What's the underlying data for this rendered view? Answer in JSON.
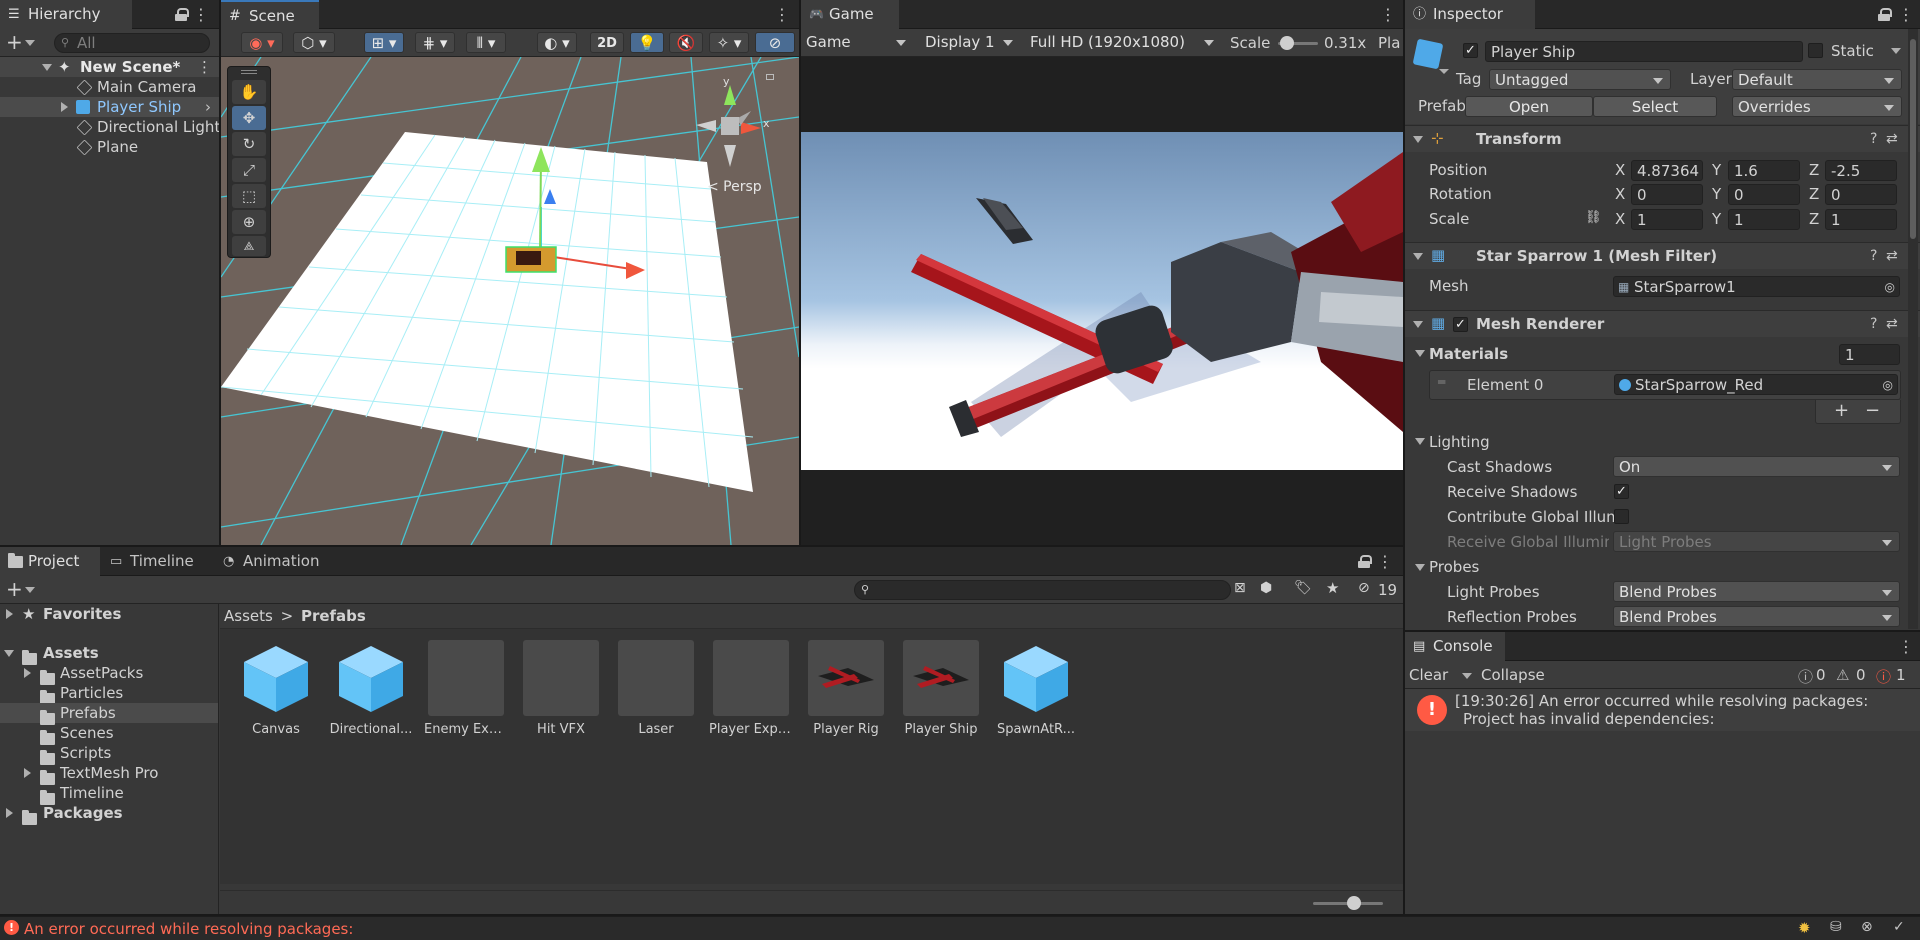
{
  "hierarchy": {
    "tab": "Hierarchy",
    "search_placeholder": "All",
    "items": [
      {
        "label": "New Scene*"
      },
      {
        "label": "Main Camera"
      },
      {
        "label": "Player Ship"
      },
      {
        "label": "Directional Light"
      },
      {
        "label": "Plane"
      }
    ]
  },
  "scene": {
    "tab": "Scene",
    "toggle_2d": "2D",
    "persp_label": "< Persp",
    "gizmo_x": "x",
    "gizmo_y": "y"
  },
  "game": {
    "tab": "Game",
    "mode": "Game",
    "display": "Display 1",
    "resolution": "Full HD (1920x1080)",
    "scale_label": "Scale",
    "scale_value": "0.31x",
    "play_label": "Pla"
  },
  "inspector": {
    "tab": "Inspector",
    "object_name": "Player Ship",
    "static_label": "Static",
    "tag_label": "Tag",
    "tag_value": "Untagged",
    "layer_label": "Layer",
    "layer_value": "Default",
    "prefab_label": "Prefab",
    "open_button": "Open",
    "select_button": "Select",
    "overrides": "Overrides",
    "transform": {
      "title": "Transform",
      "position_label": "Position",
      "rotation_label": "Rotation",
      "scale_label": "Scale",
      "axis_x": "X",
      "axis_y": "Y",
      "axis_z": "Z",
      "position": {
        "x": "4.87364",
        "y": "1.6",
        "z": "-2.5"
      },
      "rotation": {
        "x": "0",
        "y": "0",
        "z": "0"
      },
      "scale": {
        "x": "1",
        "y": "1",
        "z": "1"
      }
    },
    "mesh_filter": {
      "title": "Star Sparrow 1 (Mesh Filter)",
      "mesh_label": "Mesh",
      "mesh_value": "StarSparrow1"
    },
    "mesh_renderer": {
      "title": "Mesh Renderer",
      "materials_label": "Materials",
      "materials_count": "1",
      "element_label": "Element 0",
      "element_value": "StarSparrow_Red",
      "add": "+",
      "remove": "−",
      "lighting_label": "Lighting",
      "cast_shadows_label": "Cast Shadows",
      "cast_shadows_value": "On",
      "receive_shadows_label": "Receive Shadows",
      "contribute_gi_label": "Contribute Global Illum",
      "receive_gi_label": "Receive Global Illumina",
      "receive_gi_value": "Light Probes",
      "probes_label": "Probes",
      "light_probes_label": "Light Probes",
      "light_probes_value": "Blend Probes",
      "reflection_probes_label": "Reflection Probes",
      "reflection_probes_value": "Blend Probes"
    }
  },
  "project": {
    "tabs": [
      "Project",
      "Timeline",
      "Animation"
    ],
    "hidden_count": "19",
    "favorites": "Favorites",
    "assets_root": "Assets",
    "folders": [
      "AssetPacks",
      "Particles",
      "Prefabs",
      "Scenes",
      "Scripts",
      "TextMesh Pro",
      "Timeline"
    ],
    "packages": "Packages",
    "breadcrumb": [
      "Assets",
      "Prefabs"
    ],
    "breadcrumb_sep": ">",
    "items": [
      {
        "label": "Canvas",
        "kind": "cube"
      },
      {
        "label": "Directional...",
        "kind": "cube"
      },
      {
        "label": "Enemy Exp...",
        "kind": "blank"
      },
      {
        "label": "Hit VFX",
        "kind": "blank"
      },
      {
        "label": "Laser",
        "kind": "blank"
      },
      {
        "label": "Player Expl...",
        "kind": "blank"
      },
      {
        "label": "Player Rig",
        "kind": "ship"
      },
      {
        "label": "Player Ship",
        "kind": "ship"
      },
      {
        "label": "SpawnAtR...",
        "kind": "cube"
      }
    ]
  },
  "console": {
    "tab": "Console",
    "clear": "Clear",
    "collapse": "Collapse",
    "log_count": "0",
    "warn_count": "0",
    "error_count": "1",
    "message_line1": "[19:30:26] An error occurred while resolving packages:",
    "message_line2": "Project has invalid dependencies:"
  },
  "status_bar": {
    "message": "An error occurred while resolving packages:",
    "error_color": "#ff5a44"
  }
}
